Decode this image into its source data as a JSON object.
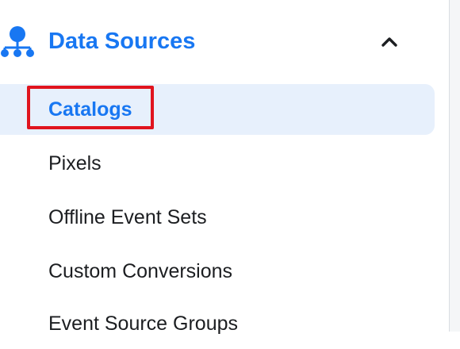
{
  "section": {
    "title": "Data Sources",
    "icon": "data-sources-icon",
    "expanded": true,
    "toggle_icon": "chevron-up-icon"
  },
  "items": [
    {
      "label": "Catalogs",
      "selected": true
    },
    {
      "label": "Pixels",
      "selected": false
    },
    {
      "label": "Offline Event Sets",
      "selected": false
    },
    {
      "label": "Custom Conversions",
      "selected": false
    },
    {
      "label": "Event Source Groups",
      "selected": false
    }
  ],
  "colors": {
    "accent": "#1877f2",
    "selected_bg": "#e7f0fc",
    "text": "#1c1e21",
    "highlight": "#e0141e"
  }
}
